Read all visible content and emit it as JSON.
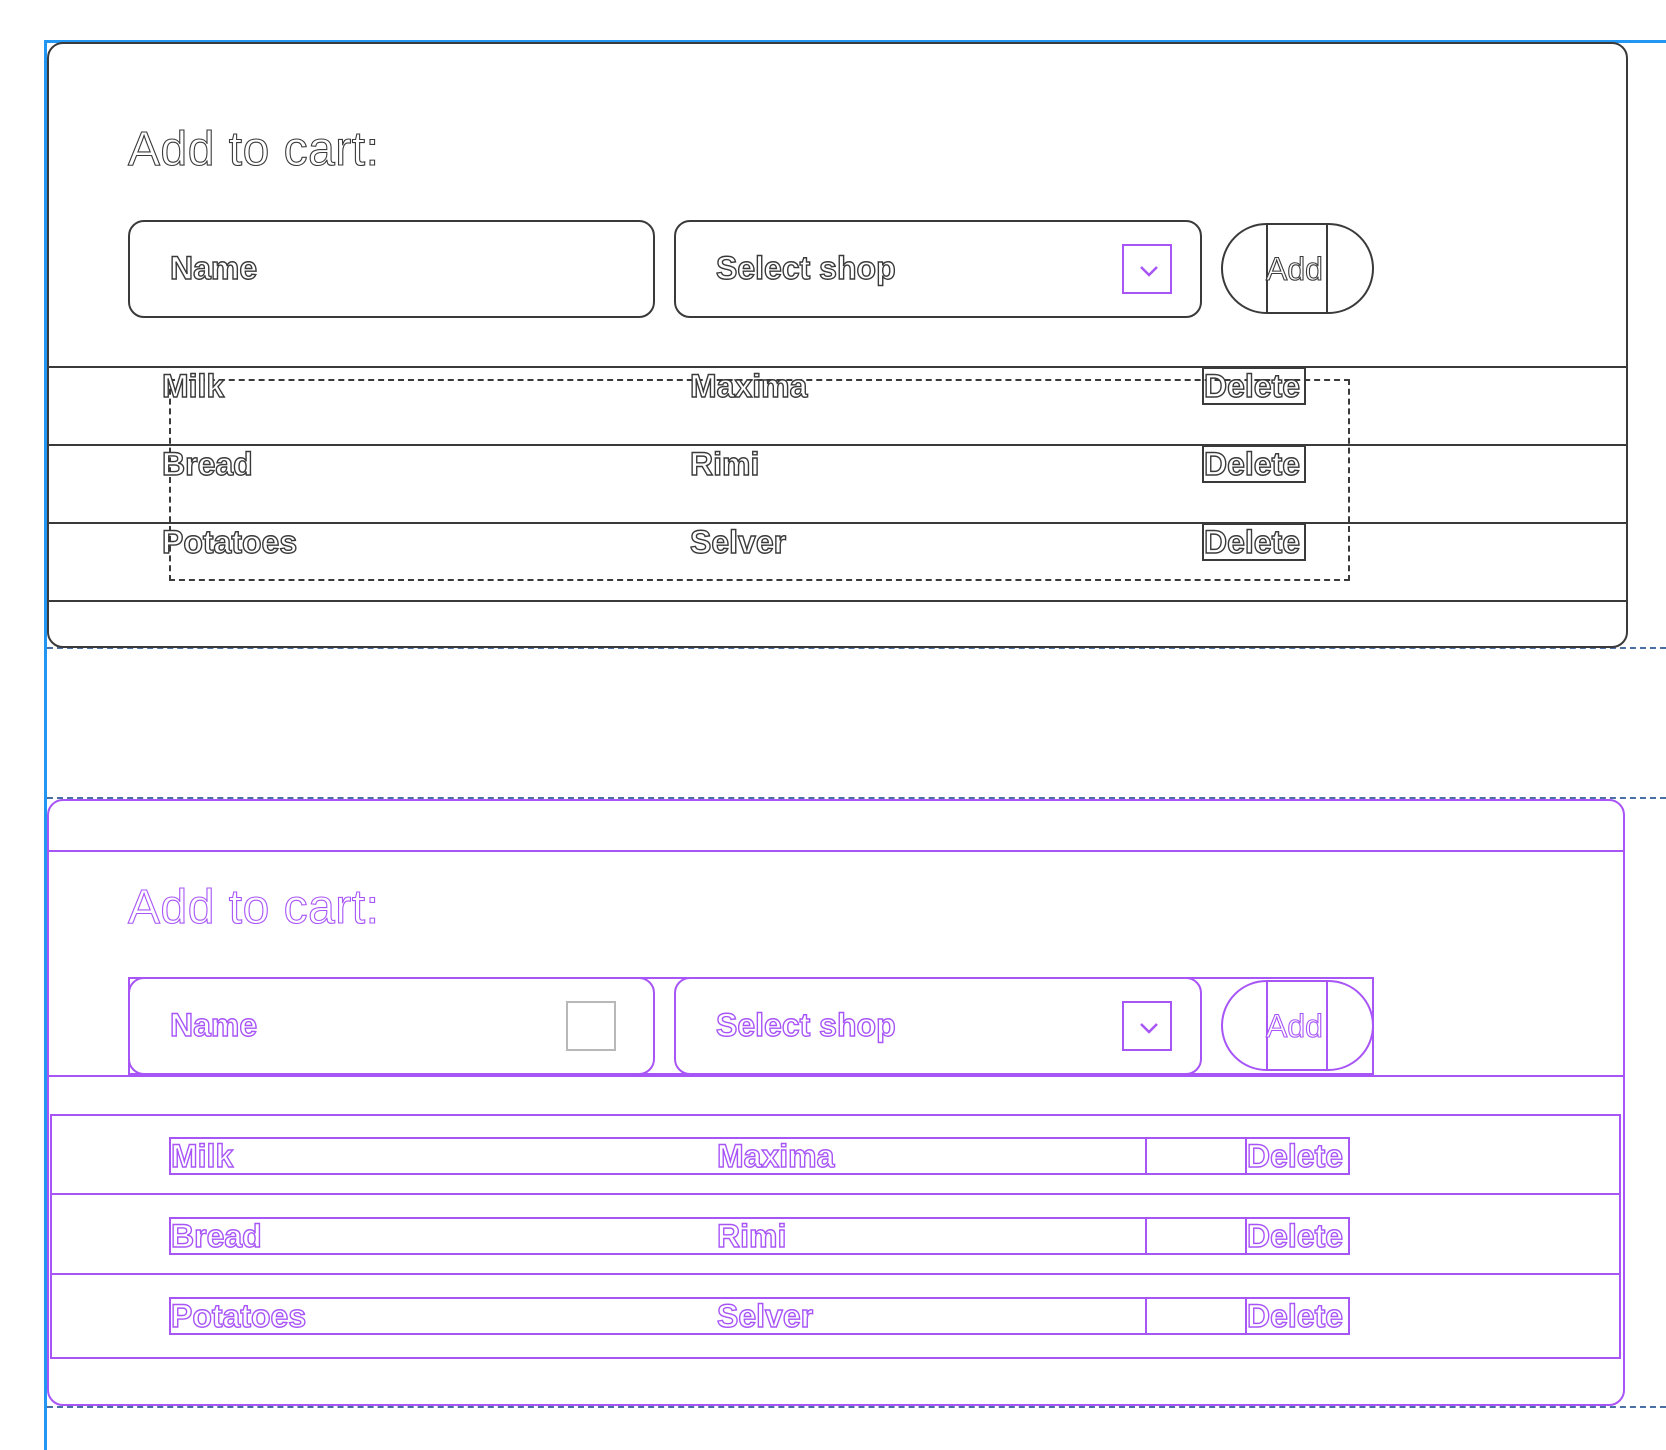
{
  "top_panel": {
    "title": "Add to cart:",
    "name_placeholder": "Name",
    "select_placeholder": "Select shop",
    "add_label": "Add",
    "rows": [
      {
        "name": "Milk",
        "shop": "Maxima",
        "action": "Delete"
      },
      {
        "name": "Bread",
        "shop": "Rimi",
        "action": "Delete"
      },
      {
        "name": "Potatoes",
        "shop": "Selver",
        "action": "Delete"
      }
    ]
  },
  "bottom_panel": {
    "title": "Add to cart:",
    "name_placeholder": "Name",
    "select_placeholder": "Select shop",
    "add_label": "Add",
    "rows": [
      {
        "name": "Milk",
        "shop": "Maxima",
        "action": "Delete"
      },
      {
        "name": "Bread",
        "shop": "Rimi",
        "action": "Delete"
      },
      {
        "name": "Potatoes",
        "shop": "Selver",
        "action": "Delete"
      }
    ]
  },
  "colors": {
    "frame": "#2196f3",
    "dark_stroke": "#3a3a3a",
    "accent_purple": "#a855f7",
    "guide_dashed": "#4a6fa5"
  },
  "icons": {
    "dropdown": "chevron-down-icon"
  }
}
